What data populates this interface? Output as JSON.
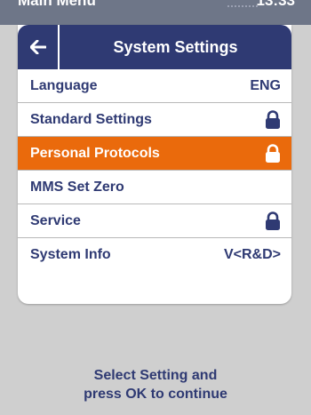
{
  "status_bar": {
    "title": "Main Menu",
    "time": "13:33"
  },
  "header": {
    "back_icon": "arrow-left-icon",
    "title": "System Settings"
  },
  "colors": {
    "header_bg": "#2f3a73",
    "selected_bg": "#ea6a0c",
    "text": "#2f3a73"
  },
  "menu": {
    "items": [
      {
        "label": "Language",
        "value": "ENG",
        "icon": ""
      },
      {
        "label": "Standard Settings",
        "value": "",
        "icon": "lock-icon"
      },
      {
        "label": "Personal Protocols",
        "value": "",
        "icon": "lock-icon",
        "selected": true
      },
      {
        "label": "MMS Set Zero",
        "value": "",
        "icon": ""
      },
      {
        "label": "Service",
        "value": "",
        "icon": "lock-icon"
      },
      {
        "label": "System Info",
        "value": "V<R&D>",
        "icon": ""
      }
    ]
  },
  "footer": {
    "line1": "Select Setting and",
    "line2": "press OK to continue"
  }
}
